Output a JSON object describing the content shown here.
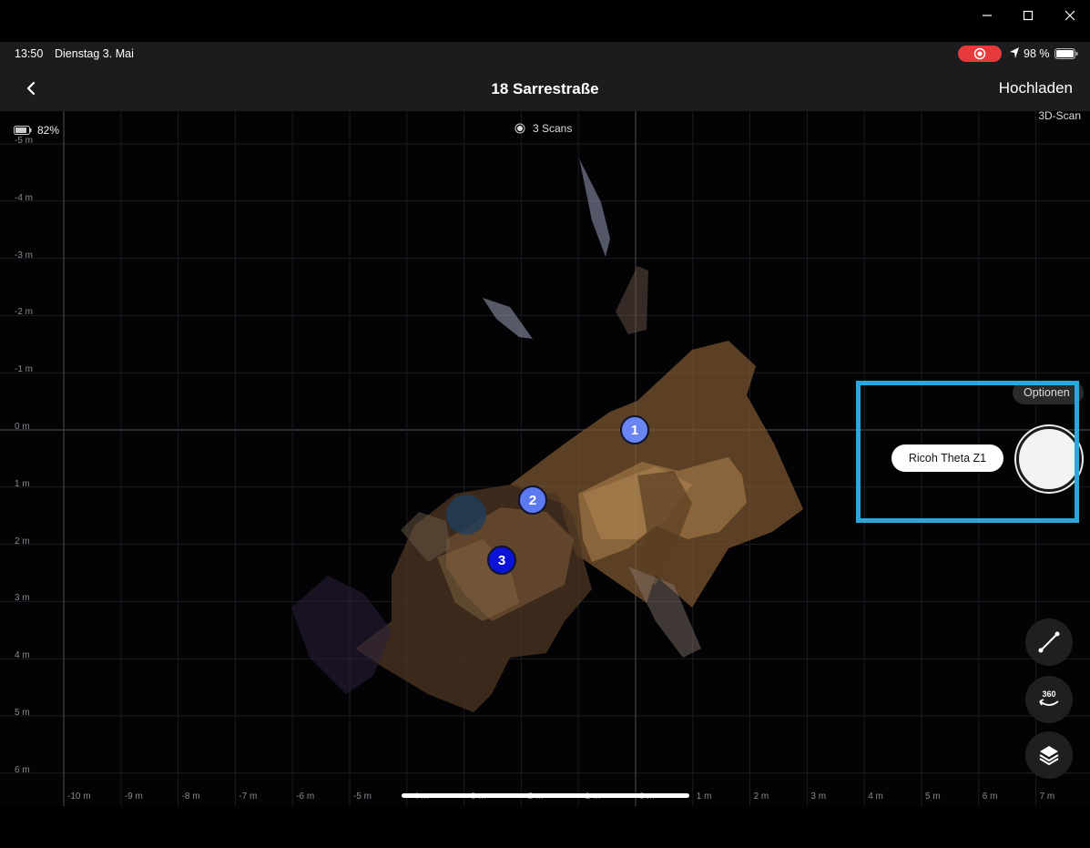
{
  "window": {
    "controls": [
      "minimize-icon",
      "maximize-icon",
      "close-icon"
    ]
  },
  "status_bar": {
    "time": "13:50",
    "date": "Dienstag 3. Mai",
    "battery_percent": "98 %",
    "recording_color": "#e5393a",
    "icons": [
      "screen-record-icon",
      "location-arrow-icon",
      "battery-icon"
    ]
  },
  "nav": {
    "title": "18 Sarrestraße",
    "upload_label": "Hochladen",
    "back_icon": "chevron-left-icon"
  },
  "map": {
    "device_battery": "82%",
    "scan_count": "3 Scans",
    "mode_label": "3D-Scan",
    "y_labels": [
      "-5 m",
      "-4 m",
      "-3 m",
      "-2 m",
      "-1 m",
      "0 m",
      "1 m",
      "2 m",
      "3 m",
      "4 m",
      "5 m",
      "6 m"
    ],
    "x_labels": [
      "-10 m",
      "-9 m",
      "-8 m",
      "-7 m",
      "-6 m",
      "-5 m",
      "-4 m",
      "-3 m",
      "-2 m",
      "-1 m",
      "0 m",
      "1 m",
      "2 m",
      "3 m",
      "4 m",
      "5 m",
      "6 m",
      "7 m"
    ],
    "scan_points": [
      {
        "label": "1",
        "color": "#6a86f2"
      },
      {
        "label": "2",
        "color": "#5c79ef"
      },
      {
        "label": "3",
        "color": "#0b14d6"
      }
    ]
  },
  "capture": {
    "options_label": "Optionen",
    "camera_label": "Ricoh Theta Z1",
    "highlight_color": "#29a8e0"
  },
  "tools": [
    "measure-line-icon",
    "view-360-icon",
    "layers-icon"
  ]
}
